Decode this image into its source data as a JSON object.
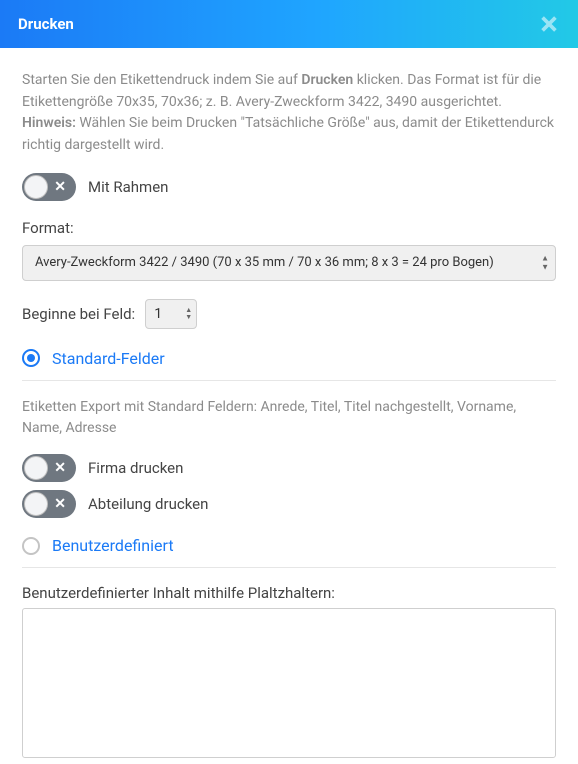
{
  "header": {
    "title": "Drucken"
  },
  "intro": {
    "part1": "Starten Sie den Etikettendruck indem Sie auf ",
    "bold1": "Drucken",
    "part2": " klicken. Das Format ist für die Etikettengröße 70x35, 70x36; z. B. Avery-Zweckform 3422, 3490 ausgerichtet.",
    "hint_label": "Hinweis:",
    "hint_text": " Wählen Sie beim Drucken \"Tatsächliche Größe\" aus, damit der Etikettendurck richtig dargestellt wird."
  },
  "toggles": {
    "mit_rahmen": {
      "label": "Mit Rahmen",
      "state": "off"
    },
    "firma_drucken": {
      "label": "Firma drucken",
      "state": "off"
    },
    "abteilung_drucken": {
      "label": "Abteilung drucken",
      "state": "off"
    }
  },
  "format": {
    "label": "Format:",
    "selected": "Avery-Zweckform 3422 / 3490 (70 x 35 mm / 70 x 36 mm; 8 x 3 = 24 pro Bogen)"
  },
  "begin_field": {
    "label": "Beginne bei Feld:",
    "value": "1"
  },
  "radios": {
    "standard": {
      "label": "Standard-Felder",
      "checked": true
    },
    "custom": {
      "label": "Benutzerdefiniert",
      "checked": false
    }
  },
  "standard_desc": "Etiketten Export mit Standard Feldern: Anrede, Titel, Titel nachgestellt, Vorname, Name, Adresse",
  "custom_area": {
    "label": "Benutzerdefinierter Inhalt mithilfe Plaltzhaltern:",
    "value": ""
  }
}
